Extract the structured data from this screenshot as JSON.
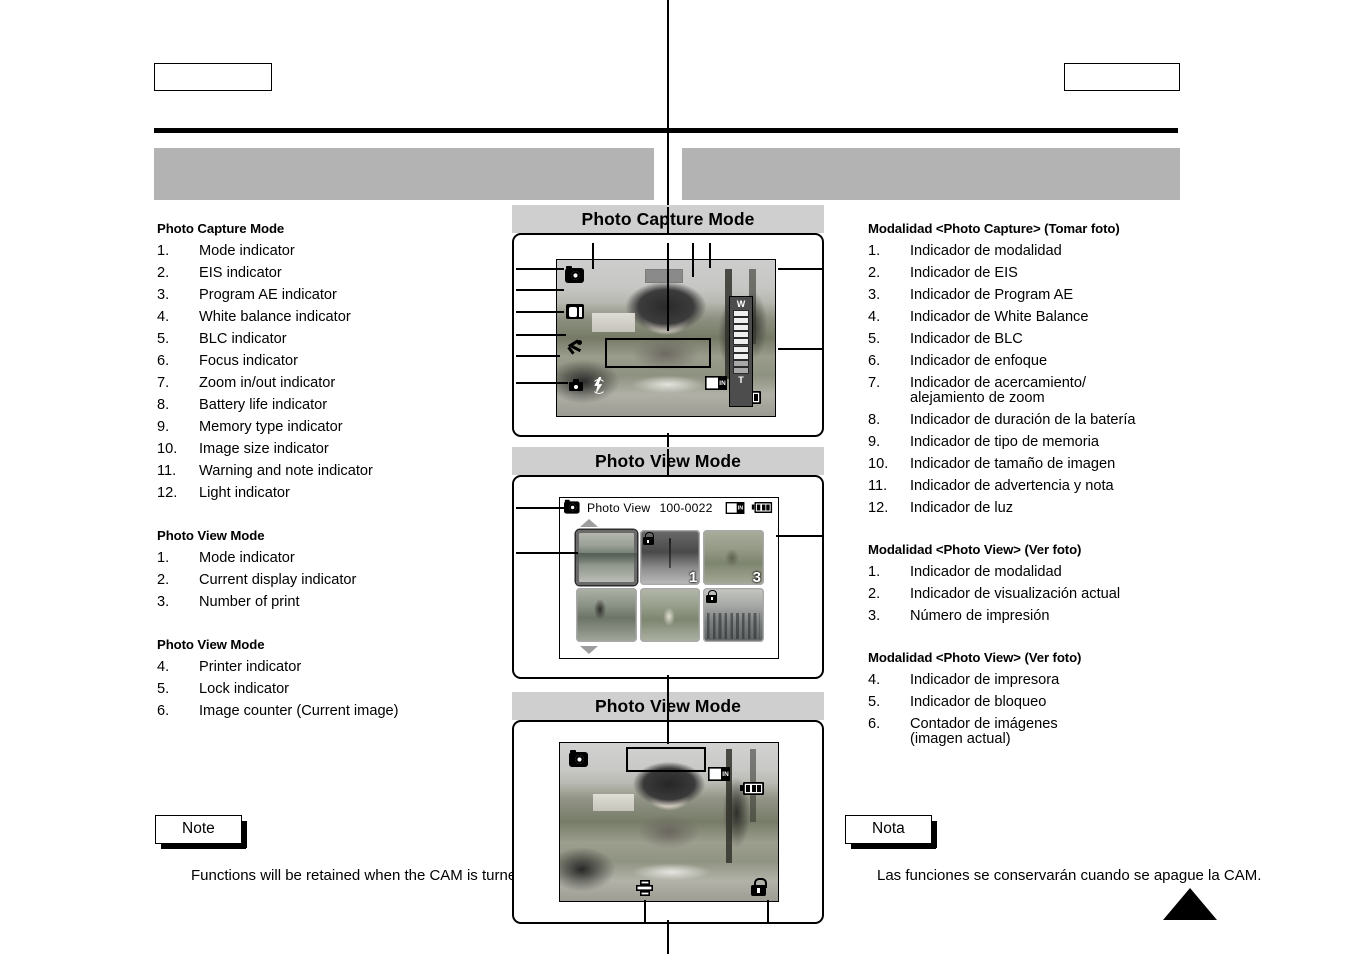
{
  "header": {
    "page_box_left": "",
    "page_box_right": "",
    "title_bar_left": "",
    "title_bar_right": ""
  },
  "left_column": {
    "sections": [
      {
        "heading": "Photo Capture Mode",
        "items": [
          {
            "num": "1.",
            "text": "Mode indicator"
          },
          {
            "num": "2.",
            "text": "EIS indicator"
          },
          {
            "num": "3.",
            "text": "Program AE indicator"
          },
          {
            "num": "4.",
            "text": "White balance indicator"
          },
          {
            "num": "5.",
            "text": "BLC indicator"
          },
          {
            "num": "6.",
            "text": "Focus indicator"
          },
          {
            "num": "7.",
            "text": "Zoom in/out indicator"
          },
          {
            "num": "8.",
            "text": "Battery life indicator"
          },
          {
            "num": "9.",
            "text": "Memory type indicator"
          },
          {
            "num": "10.",
            "text": "Image size indicator"
          },
          {
            "num": "11.",
            "text": "Warning and note indicator"
          },
          {
            "num": "12.",
            "text": "Light indicator"
          }
        ]
      },
      {
        "heading": "Photo View Mode",
        "items": [
          {
            "num": "1.",
            "text": "Mode indicator"
          },
          {
            "num": "2.",
            "text": "Current display indicator"
          },
          {
            "num": "3.",
            "text": "Number of print"
          }
        ]
      },
      {
        "heading": "Photo View Mode",
        "items": [
          {
            "num": "4.",
            "text": "Printer indicator"
          },
          {
            "num": "5.",
            "text": "Lock indicator"
          },
          {
            "num": "6.",
            "text": "Image counter (Current image)"
          }
        ]
      }
    ],
    "note": {
      "label": "Note",
      "body": "Functions will be retained when the CAM is turned off ."
    }
  },
  "right_column": {
    "sections": [
      {
        "heading": "Modalidad <Photo Capture> (Tomar foto)",
        "items": [
          {
            "num": "1.",
            "text": "Indicador de modalidad"
          },
          {
            "num": "2.",
            "text": "Indicador de EIS"
          },
          {
            "num": "3.",
            "text": "Indicador de Program AE"
          },
          {
            "num": "4.",
            "text": "Indicador de White Balance"
          },
          {
            "num": "5.",
            "text": "Indicador de BLC"
          },
          {
            "num": "6.",
            "text": "Indicador de enfoque"
          },
          {
            "num": "7.",
            "text": "Indicador de acercamiento/",
            "cont": "alejamiento de zoom"
          },
          {
            "num": "8.",
            "text": "Indicador de duración de la batería"
          },
          {
            "num": "9.",
            "text": "Indicador de tipo de memoria"
          },
          {
            "num": "10.",
            "text": "Indicador de tamaño de imagen"
          },
          {
            "num": "11.",
            "text": "Indicador de advertencia y nota"
          },
          {
            "num": "12.",
            "text": "Indicador de luz"
          }
        ]
      },
      {
        "heading": "Modalidad <Photo View> (Ver foto)",
        "items": [
          {
            "num": "1.",
            "text": "Indicador de modalidad"
          },
          {
            "num": "2.",
            "text": "Indicador de visualización actual"
          },
          {
            "num": "3.",
            "text": "Número de impresión"
          }
        ]
      },
      {
        "heading": "Modalidad <Photo View> (Ver foto)",
        "items": [
          {
            "num": "4.",
            "text": "Indicador de impresora"
          },
          {
            "num": "5.",
            "text": "Indicador de bloqueo"
          },
          {
            "num": "6.",
            "text": "Contador de imágenes",
            "cont": "(imagen actual)"
          }
        ]
      }
    ],
    "note": {
      "label": "Nota",
      "body": "Las funciones se conservarán cuando se apague la CAM."
    }
  },
  "panels": [
    {
      "title": "Photo Capture Mode",
      "screen": {
        "mode_icon": "camera-icon",
        "eis_icon": "eis-icon",
        "program_ae_icon": "program-ae-icon",
        "white_balance_icon": "white-balance-icon",
        "blc_icon": "blc-icon",
        "light_icon": "flash-icon",
        "hand_icon": "anti-shake-hand-icon",
        "memory_label": "IN",
        "battery_bars": 3,
        "zoom_wide_label": "W",
        "zoom_tele_label": "T",
        "zoom_segments": 9,
        "zoom_filled": 7
      }
    },
    {
      "title": "Photo View Mode",
      "screen": {
        "mode_icon": "camera-icon",
        "header_title": "Photo View",
        "file_number": "100-0022",
        "memory_label": "IN",
        "battery_bars": 3,
        "thumbnails": [
          {
            "index": 1,
            "selected": true,
            "locked": false,
            "print_count": ""
          },
          {
            "index": 2,
            "selected": false,
            "locked": true,
            "print_count": "1"
          },
          {
            "index": 3,
            "selected": false,
            "locked": false,
            "print_count": "3"
          },
          {
            "index": 4,
            "selected": false,
            "locked": false,
            "print_count": ""
          },
          {
            "index": 5,
            "selected": false,
            "locked": false,
            "print_count": ""
          },
          {
            "index": 6,
            "selected": false,
            "locked": true,
            "print_count": ""
          }
        ]
      }
    },
    {
      "title": "Photo View Mode",
      "screen": {
        "mode_icon": "camera-icon",
        "memory_label": "IN",
        "battery_bars": 3,
        "printer_icon": "printer-icon",
        "lock_icon": "lock-icon"
      }
    }
  ],
  "colors": {
    "title_bar": "#cfcfcf",
    "header_bar": "#b3b3b3",
    "rule": "#000000"
  }
}
